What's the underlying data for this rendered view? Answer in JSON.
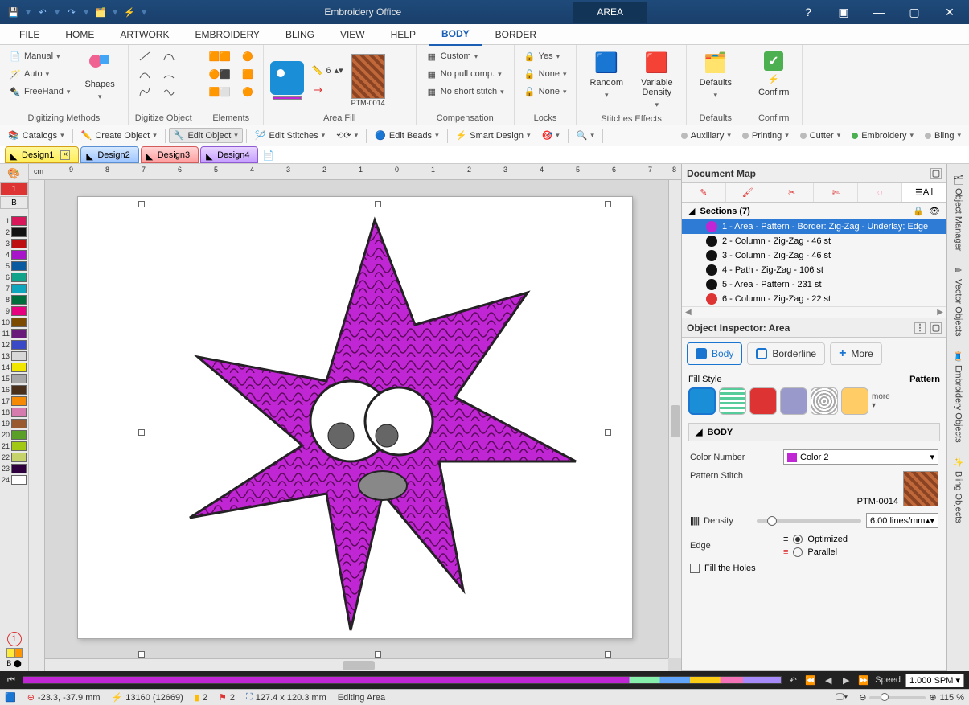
{
  "titlebar": {
    "app": "Embroidery Office",
    "context": "AREA"
  },
  "menutabs": [
    "FILE",
    "HOME",
    "ARTWORK",
    "EMBROIDERY",
    "BLING",
    "VIEW",
    "HELP",
    "BODY",
    "BORDER"
  ],
  "menutabs_active": "BODY",
  "ribbon": {
    "group1": {
      "title": "Digitizing Methods",
      "manual": "Manual",
      "auto": "Auto",
      "freehand": "FreeHand",
      "shapes": "Shapes"
    },
    "group2": {
      "title": "Digitize Object"
    },
    "group3": {
      "title": "Elements"
    },
    "group4": {
      "title": "Area Fill",
      "density_label_num": "6",
      "pattern": "PTM-0014"
    },
    "group5": {
      "title": "Compensation",
      "custom": "Custom",
      "pull": "No pull comp.",
      "shortstitch": "No short stitch"
    },
    "group6": {
      "title": "Locks",
      "yes": "Yes",
      "none1": "None",
      "none2": "None"
    },
    "group7": {
      "title": "Stitches Effects",
      "random": "Random",
      "variable": "Variable\nDensity"
    },
    "group8": {
      "title": "Defaults",
      "defaults": "Defaults"
    },
    "group9": {
      "title": "Confirm",
      "confirm": "Confirm"
    }
  },
  "toolbar2": {
    "catalogs": "Catalogs",
    "create": "Create Object",
    "edit": "Edit Object",
    "editstitches": "Edit Stitches",
    "editbeads": "Edit Beads",
    "smart": "Smart Design",
    "aux": "Auxiliary",
    "printing": "Printing",
    "cutter": "Cutter",
    "embroidery": "Embroidery",
    "bling": "Bling"
  },
  "designtabs": [
    "Design1",
    "Design2",
    "Design3",
    "Design4"
  ],
  "color_palette": [
    "#d8175a",
    "#111111",
    "#bd0f0f",
    "#a814c9",
    "#0a5aa0",
    "#12a38a",
    "#0fa5bc",
    "#006e3c",
    "#e6007e",
    "#7a4b00",
    "#6a1a7a",
    "#3a49c5",
    "#d8d8d8",
    "#f1e600",
    "#a7a7a7",
    "#4a2f1b",
    "#f58a07",
    "#d67bae",
    "#9a5a2f",
    "#5aa028",
    "#a0c814",
    "#c6d36b",
    "#2e003e",
    "#ffffff"
  ],
  "docmap": {
    "title": "Document Map",
    "all": "All",
    "sections_label": "Sections (7)",
    "items": [
      {
        "label": "1 - Area - Pattern - Border: Zig-Zag - Underlay: Edge",
        "col": "#c026d3",
        "selected": true
      },
      {
        "label": "2 - Column - Zig-Zag - 46 st",
        "col": "#111"
      },
      {
        "label": "3 - Column - Zig-Zag - 46 st",
        "col": "#111"
      },
      {
        "label": "4 - Path - Zig-Zag - 106 st",
        "col": "#111"
      },
      {
        "label": "5 - Area - Pattern - 231 st",
        "col": "#111"
      },
      {
        "label": "6 - Column - Zig-Zag - 22 st",
        "col": "#d33"
      }
    ]
  },
  "inspector": {
    "title": "Object Inspector: Area",
    "tabs": {
      "body": "Body",
      "borderline": "Borderline",
      "more": "More"
    },
    "fillstyle_label": "Fill Style",
    "fillstyle_value": "Pattern",
    "more": "more",
    "body_header": "BODY",
    "colornumber_label": "Color Number",
    "color_value": "Color 2",
    "color_hex": "#c026d3",
    "patternstitch_label": "Pattern Stitch",
    "pattern_code": "PTM-0014",
    "density_label": "Density",
    "density_value": "6.00 lines/mm",
    "edge_label": "Edge",
    "edge_optimized": "Optimized",
    "edge_parallel": "Parallel",
    "fillholes": "Fill the Holes"
  },
  "farright": [
    "Object Manager",
    "Vector Objects",
    "Embroidery Objects",
    "Bling Objects"
  ],
  "timeline": {
    "speed_label": "Speed",
    "speed_value": "1.000 SPM"
  },
  "status": {
    "coords": "-23.3, -37.9 mm",
    "stitches": "13160 (12669)",
    "layers": "2",
    "needles": "2",
    "size": "127.4 x 120.3 mm",
    "mode": "Editing Area",
    "zoom": "115 %"
  }
}
